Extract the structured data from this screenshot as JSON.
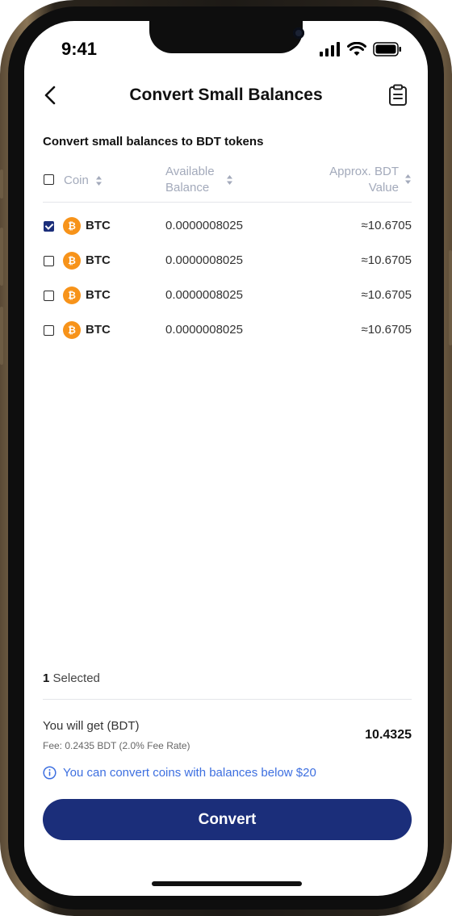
{
  "status": {
    "time": "9:41"
  },
  "header": {
    "title": "Convert Small Balances"
  },
  "subtitle": "Convert small balances to BDT tokens",
  "table": {
    "columns": {
      "coin": "Coin",
      "balance_line1": "Available",
      "balance_line2": "Balance",
      "value_line1": "Approx. BDT",
      "value_line2": "Value"
    },
    "rows": [
      {
        "coin": "BTC",
        "icon": "bitcoin-icon",
        "balance": "0.0000008025",
        "value": "≈10.6705",
        "checked": true
      },
      {
        "coin": "BTC",
        "icon": "bitcoin-icon",
        "balance": "0.0000008025",
        "value": "≈10.6705",
        "checked": false
      },
      {
        "coin": "BTC",
        "icon": "bitcoin-icon",
        "balance": "0.0000008025",
        "value": "≈10.6705",
        "checked": false
      },
      {
        "coin": "BTC",
        "icon": "bitcoin-icon",
        "balance": "0.0000008025",
        "value": "≈10.6705",
        "checked": false
      }
    ]
  },
  "footer": {
    "selected_count": "1",
    "selected_label": "Selected",
    "get_label": "You will get (BDT)",
    "fee": "Fee: 0.2435 BDT (2.0% Fee Rate)",
    "get_value": "10.4325",
    "info": "You can convert coins with balances below $20",
    "convert_label": "Convert"
  },
  "colors": {
    "primary": "#1b2e7a",
    "bitcoin": "#f7931a",
    "info": "#3d6fe0",
    "header_text": "#a3aabb"
  }
}
